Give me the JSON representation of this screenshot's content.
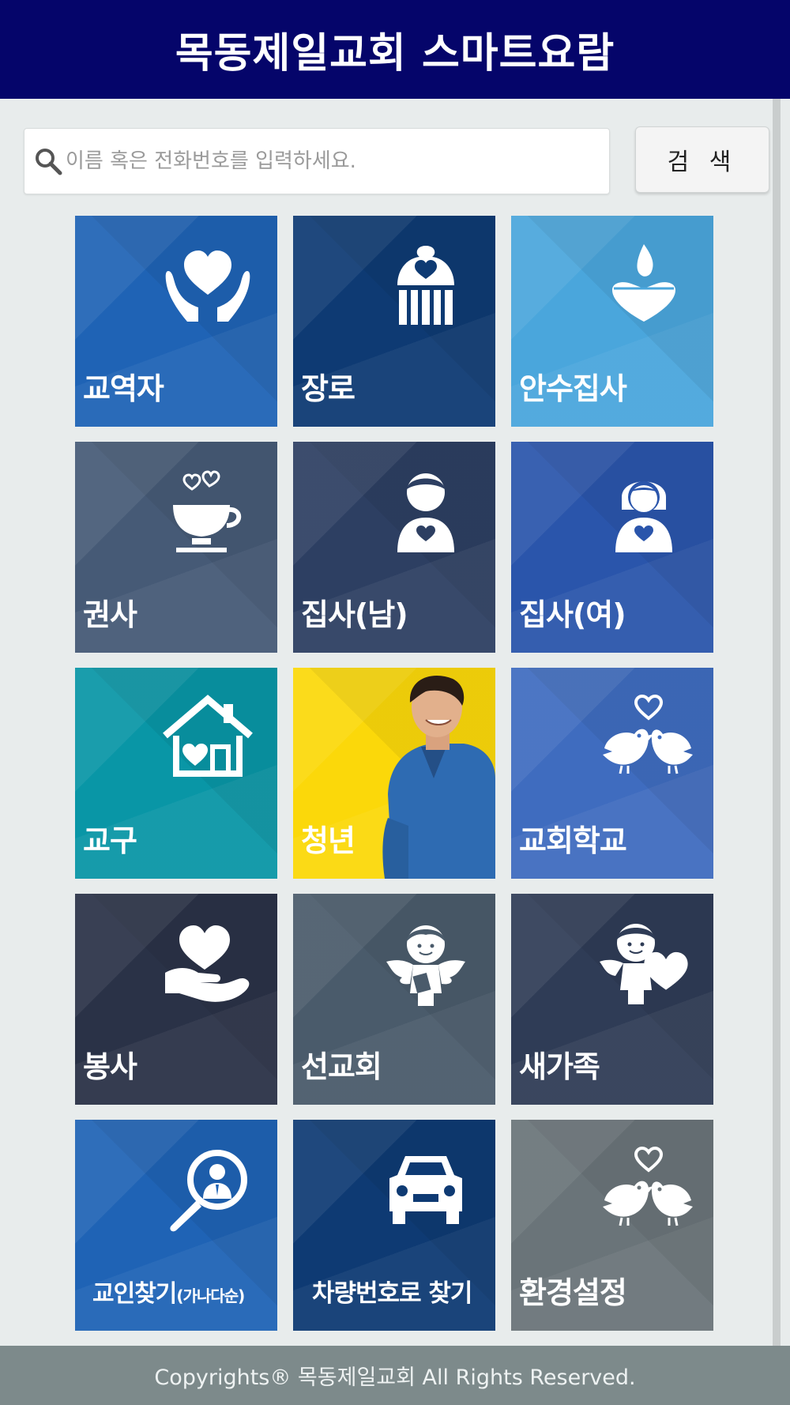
{
  "header": {
    "title": "목동제일교회 스마트요람"
  },
  "search": {
    "placeholder": "이름 혹은 전화번호를 입력하세요.",
    "value": "",
    "button_label": "검 색"
  },
  "tiles": [
    {
      "label": "교역자",
      "bg": "#1f63b5",
      "icon": "hands-heart-icon"
    },
    {
      "label": "장로",
      "bg": "#0e3a73",
      "icon": "cupcake-heart-icon"
    },
    {
      "label": "안수집사",
      "bg": "#4aa6dc",
      "icon": "candle-heart-icon"
    },
    {
      "label": "권사",
      "bg": "#465a76",
      "icon": "teacup-hearts-icon"
    },
    {
      "label": "집사(남)",
      "bg": "#2d3f62",
      "icon": "man-heart-icon"
    },
    {
      "label": "집사(여)",
      "bg": "#2a55ab",
      "icon": "woman-heart-icon"
    },
    {
      "label": "교구",
      "bg": "#0996a6",
      "icon": "house-heart-icon"
    },
    {
      "label": "청년",
      "bg": "#fbd80a",
      "icon": "young-man-photo"
    },
    {
      "label": "교회학교",
      "bg": "#3f6cbf",
      "icon": "love-birds-icon"
    },
    {
      "label": "봉사",
      "bg": "#2a3247",
      "icon": "hand-heart-icon"
    },
    {
      "label": "선교회",
      "bg": "#4a5b6b",
      "icon": "angel-icon"
    },
    {
      "label": "새가족",
      "bg": "#2f3c56",
      "icon": "cupid-heart-icon"
    },
    {
      "label": "교인찾기",
      "label_suffix": "(가나다순)",
      "bg": "#1f63b5",
      "icon": "magnifier-person-icon"
    },
    {
      "label": "차량번호로 찾기",
      "bg": "#0e3a73",
      "icon": "car-icon"
    },
    {
      "label": "환경설정",
      "bg": "#6a7479",
      "icon": "love-birds-icon"
    }
  ],
  "footer": {
    "text": "Copyrights® 목동제일교회 All Rights Reserved."
  }
}
